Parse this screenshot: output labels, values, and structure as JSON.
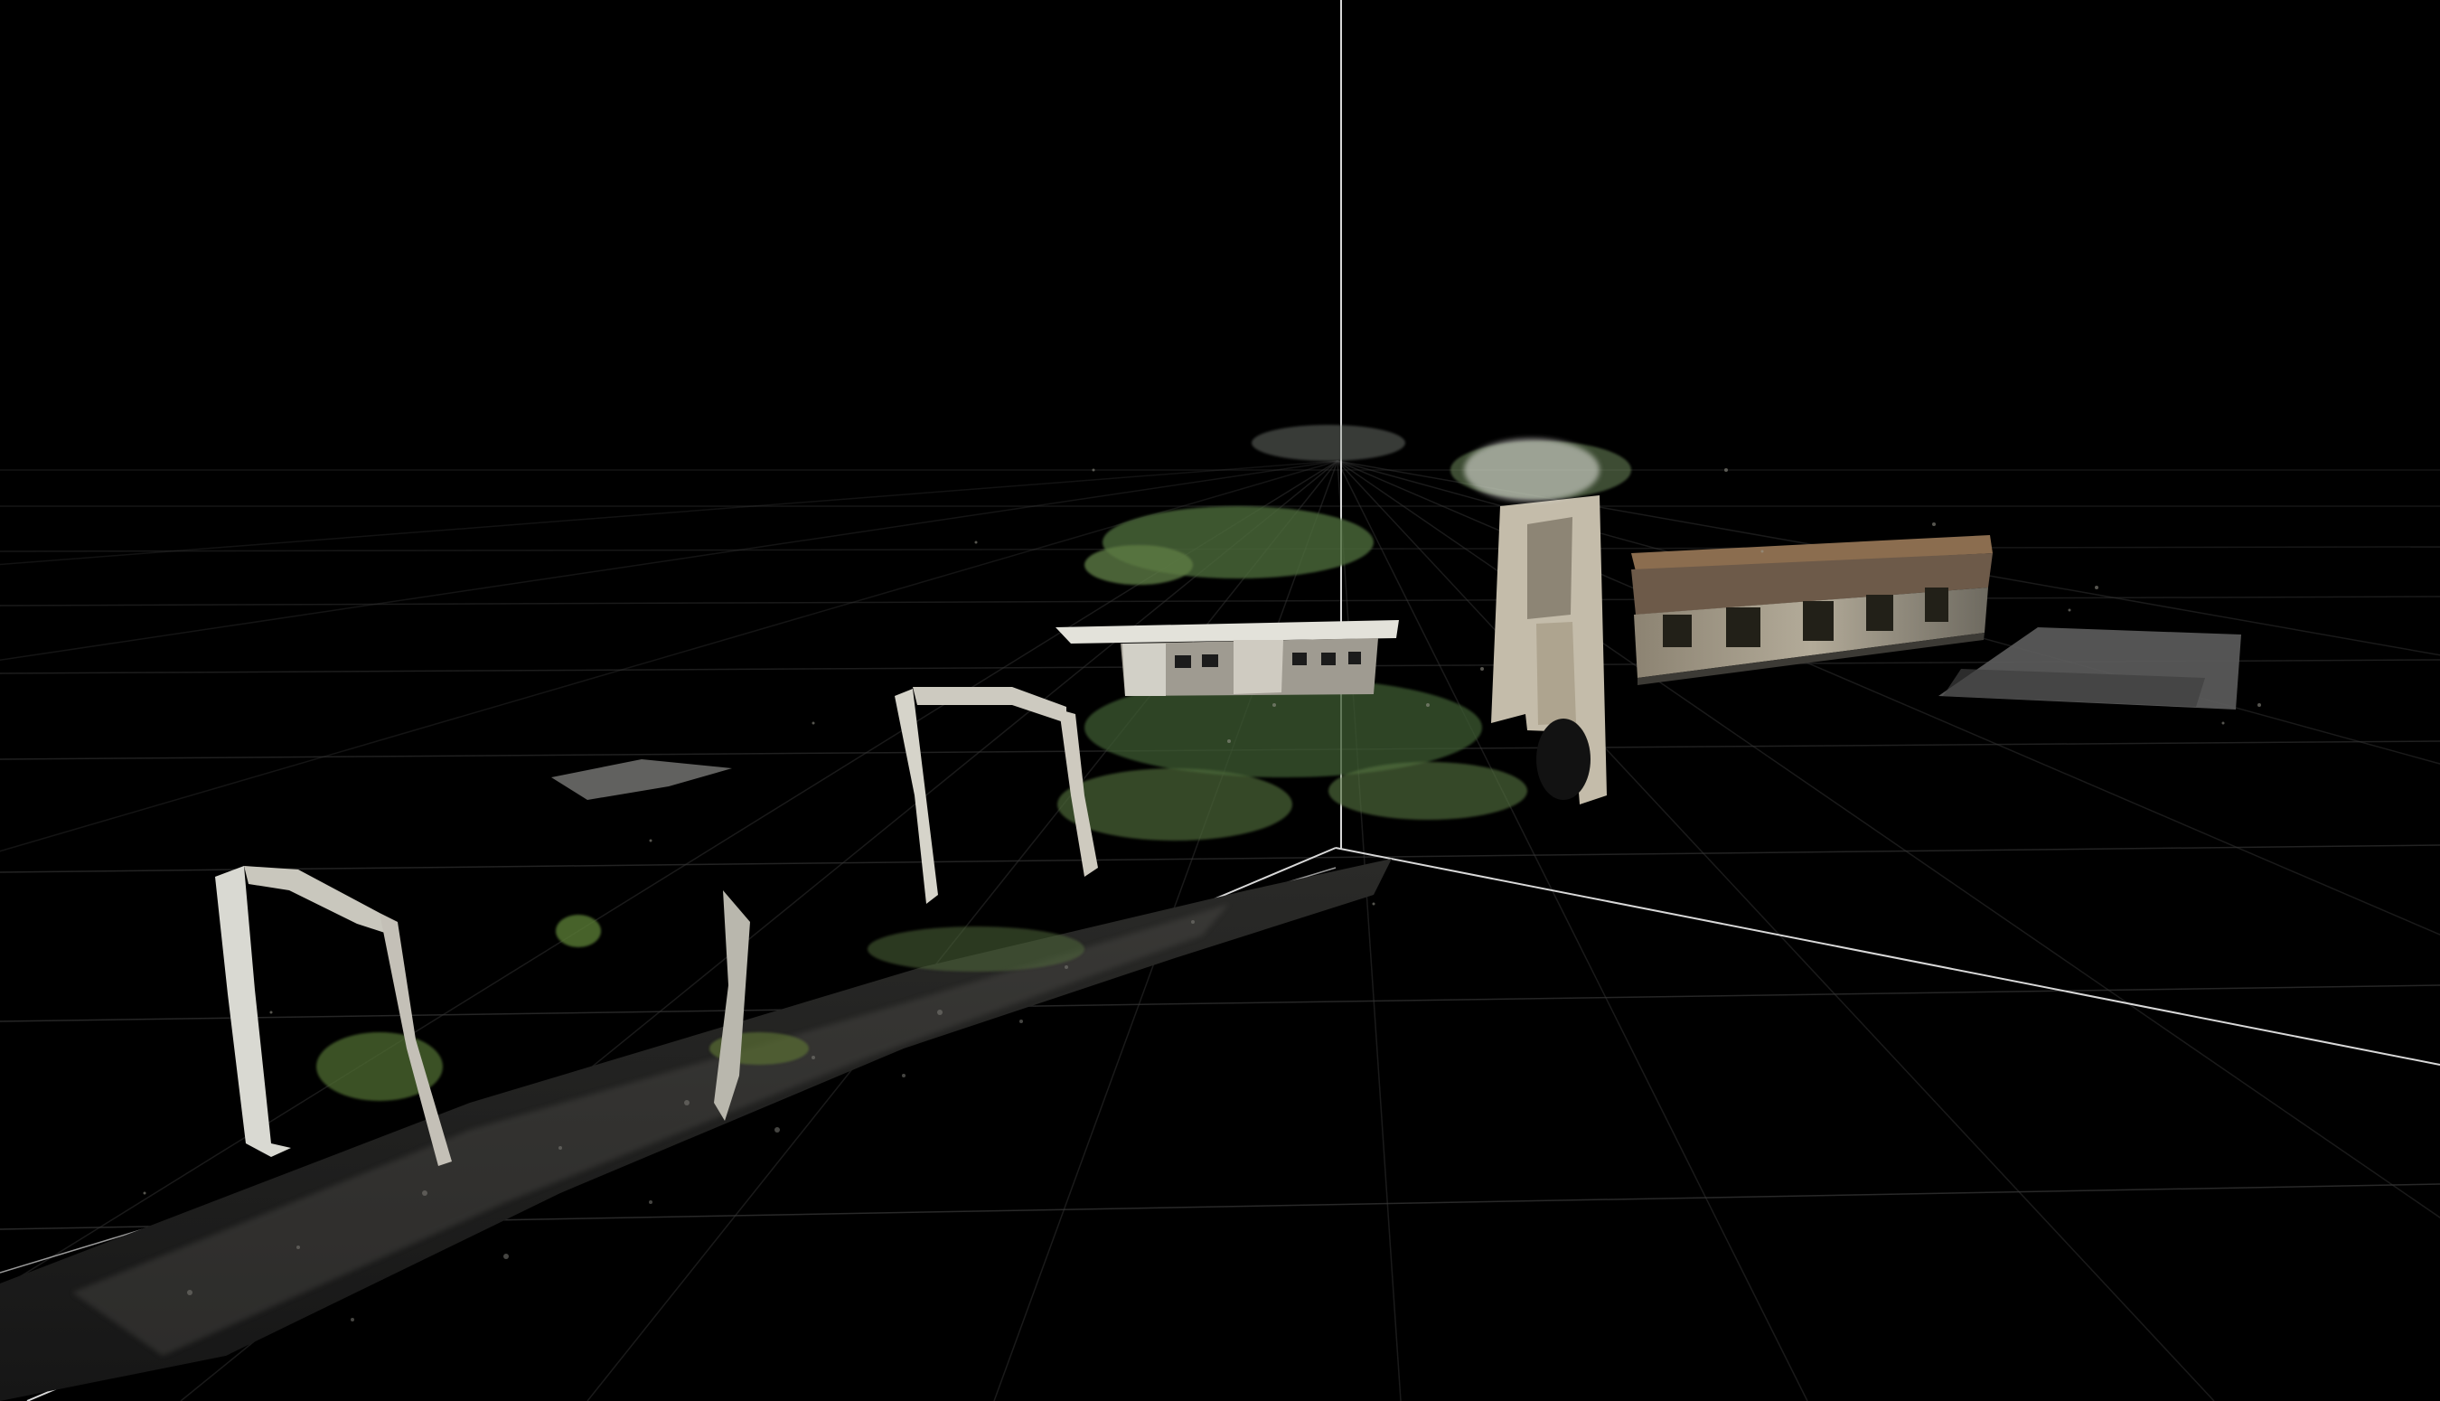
{
  "viewport": {
    "background_color": "#000000",
    "grid_color": "#3a3a3a",
    "axis_color": "#d8d8d8"
  },
  "scene": {
    "content": "point-cloud",
    "objects": [
      {
        "name": "left-archway",
        "kind": "structure",
        "color": "#d9d9d2"
      },
      {
        "name": "middle-archway",
        "kind": "structure",
        "color": "#d6d4ca"
      },
      {
        "name": "rear-building",
        "kind": "structure",
        "color": "#bdb9ac"
      },
      {
        "name": "tower",
        "kind": "structure",
        "color": "#c8c0ad"
      },
      {
        "name": "long-building",
        "kind": "structure",
        "color": "#a79d89"
      },
      {
        "name": "concrete-slab",
        "kind": "ground",
        "color": "#5d5d5d"
      },
      {
        "name": "gravel-path",
        "kind": "ground",
        "color": "#4a4a48"
      },
      {
        "name": "vegetation",
        "kind": "foliage",
        "color": "#49653a"
      }
    ]
  }
}
